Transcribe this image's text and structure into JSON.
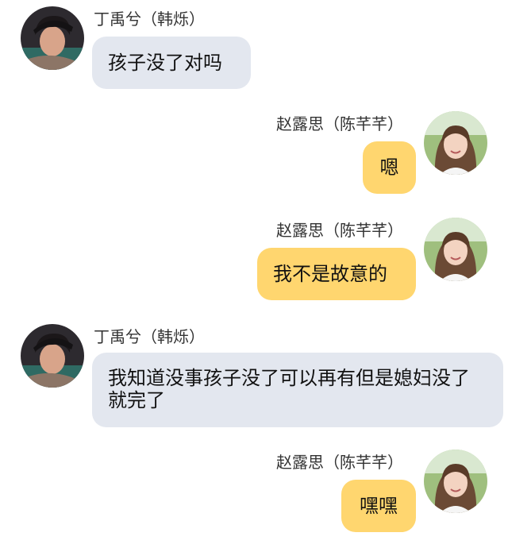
{
  "colors": {
    "left_bubble": "#e3e7ef",
    "right_bubble": "#ffd66f",
    "name_text": "#333333",
    "message_text": "#111111",
    "background": "#ffffff"
  },
  "messages": [
    {
      "side": "left",
      "sender": "丁禹兮（韩烁）",
      "text": "孩子没了对吗",
      "avatar": "male-avatar"
    },
    {
      "side": "right",
      "sender": "赵露思（陈芊芊）",
      "text": "嗯",
      "avatar": "female-avatar"
    },
    {
      "side": "right",
      "sender": "赵露思（陈芊芊）",
      "text": "我不是故意的",
      "avatar": "female-avatar"
    },
    {
      "side": "left",
      "sender": "丁禹兮（韩烁）",
      "text": "我知道没事孩子没了可以再有但是媳妇没了就完了",
      "avatar": "male-avatar"
    },
    {
      "side": "right",
      "sender": "赵露思（陈芊芊）",
      "text": "嘿嘿",
      "avatar": "female-avatar"
    }
  ]
}
